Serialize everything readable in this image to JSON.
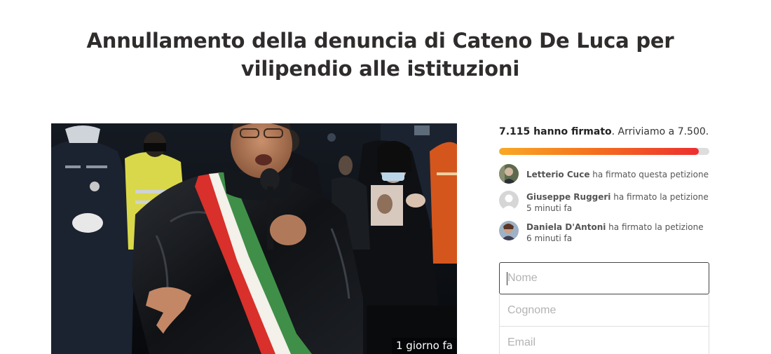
{
  "petition": {
    "title": "Annullamento della denuncia di Cateno De Luca per vilipendio alle istituzioni"
  },
  "photo": {
    "timestamp": "1 giorno fa"
  },
  "progress": {
    "signed_bold": "7.115 hanno firmato",
    "goal_text": ". Arriviamo a 7.500.",
    "signed": 7115,
    "goal": 7500,
    "fill_fraction": 0.95,
    "gradient_start": "#f9a825",
    "gradient_end": "#ec2f2f"
  },
  "signers": [
    {
      "name": "Letterio Cuce",
      "action": "ha firmato questa petizione",
      "avatar": "photo-avatar"
    },
    {
      "name": "Giuseppe Ruggeri",
      "action": "ha firmato la petizione 5 minuti fa",
      "avatar": "default-avatar"
    },
    {
      "name": "Daniela D'Antoni",
      "action": "ha firmato la petizione 6 minuti fa",
      "avatar": "photo-avatar"
    }
  ],
  "form": {
    "first_name_placeholder": "Nome",
    "last_name_placeholder": "Cognome",
    "email_placeholder": "Email"
  }
}
